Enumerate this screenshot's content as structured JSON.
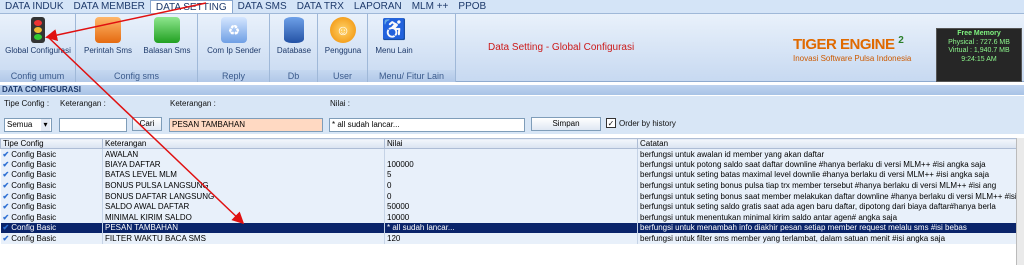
{
  "menu": [
    "DATA INDUK",
    "DATA MEMBER",
    "DATA SETTING",
    "DATA SMS",
    "DATA TRX",
    "LAPORAN",
    "MLM ++",
    "PPOB"
  ],
  "ribbon": {
    "buttons": [
      {
        "label": "Global Configurasi",
        "icon": "traffic-light-icon"
      },
      {
        "label": "Perintah Sms",
        "icon": "message-icon"
      },
      {
        "label": "Balasan Sms",
        "icon": "reply-icon"
      },
      {
        "label": "Com Ip Sender",
        "icon": "recycle-icon"
      },
      {
        "label": "Database",
        "icon": "database-icon"
      },
      {
        "label": "Pengguna",
        "icon": "smiley-icon"
      },
      {
        "label": "Menu Lain",
        "icon": "wheelchair-icon"
      }
    ],
    "groups": [
      "Config umum",
      "Config sms",
      "Reply",
      "Db",
      "User",
      "Menu/ Fitur Lain"
    ]
  },
  "title": "Data Setting - Global Configurasi",
  "logo": {
    "brand": "TIGER ENGINE",
    "version": "2",
    "tagline": "Inovasi Software Pulsa Indonesia"
  },
  "memory": {
    "title": "Free Memory",
    "physical": "Physical : 727.6 MB",
    "virtual": "Virtual : 1,940.7 MB",
    "time": "9:24:15 AM"
  },
  "panel": {
    "title": "DATA CONFIGURASI",
    "tipe_label": "Tipe Config :",
    "tipe_value": "Semua",
    "keterangan_label": "Keterangan :",
    "keterangan_label2": "Keterangan :",
    "keterangan_value": "PESAN TAMBAHAN",
    "nilai_label": "Nilai :",
    "nilai_value": "* all sudah lancar...",
    "cari": "Cari",
    "simpan": "Simpan",
    "order": "Order by history"
  },
  "grid": {
    "columns": [
      "Tipe Config",
      "Keterangan",
      "Nilai",
      "Catatan"
    ],
    "rows": [
      [
        "Config Basic",
        "AWALAN",
        "",
        "berfungsi untuk awalan id member yang akan daftar"
      ],
      [
        "Config Basic",
        "BIAYA DAFTAR",
        "100000",
        "berfungsi untuk potong saldo saat daftar downline #hanya berlaku di versi MLM++ #isi angka saja"
      ],
      [
        "Config Basic",
        "BATAS LEVEL MLM",
        "5",
        "berfungsi untuk seting batas maximal level downlie #hanya berlaku di versi MLM++ #isi angka saja"
      ],
      [
        "Config Basic",
        "BONUS PULSA LANGSUNG",
        "0",
        "berfungsi untuk seting bonus pulsa tiap trx member tersebut #hanya berlaku di versi MLM++ #isi ang"
      ],
      [
        "Config Basic",
        "BONUS DAFTAR LANGSUNG",
        "0",
        "berfungsi untuk seting bonus saat member melakukan daftar downline #hanya berlaku di versi MLM++ #isi"
      ],
      [
        "Config Basic",
        "SALDO AWAL DAFTAR",
        "50000",
        "berfungsi untuk seting saldo gratis saat ada agen baru daftar, dipotong dari biaya daftar#hanya berla"
      ],
      [
        "Config Basic",
        "MINIMAL KIRIM SALDO",
        "10000",
        "berfungsi untuk menentukan minimal kirim saldo antar agen# angka saja"
      ],
      [
        "Config Basic",
        "PESAN TAMBAHAN",
        "* all sudah lancar...",
        "berfungsi untuk menambah info diakhir pesan setiap member request melalu sms #isi bebas"
      ],
      [
        "Config Basic",
        "FILTER WAKTU BACA SMS",
        "120",
        "berfungsi untuk filter sms member yang terlambat, dalam satuan menit #isi angka saja"
      ]
    ],
    "selected_index": 7
  }
}
